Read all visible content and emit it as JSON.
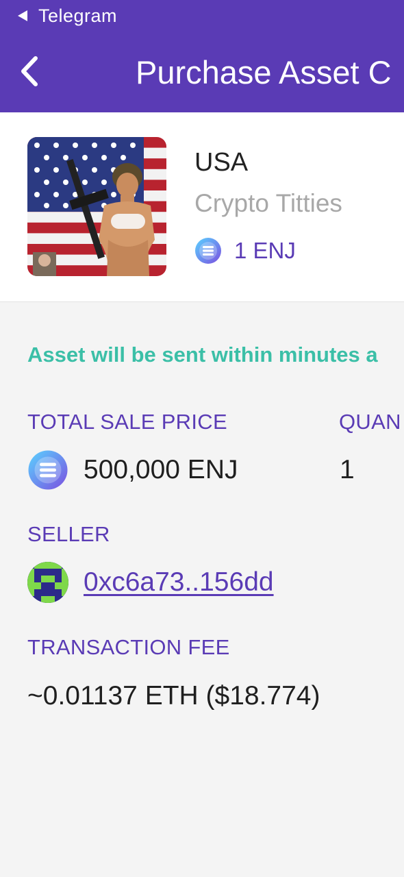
{
  "status_bar": {
    "back_app": "Telegram"
  },
  "header": {
    "title": "Purchase Asset C"
  },
  "asset": {
    "name": "USA",
    "collection": "Crypto Titties",
    "price": "1 ENJ",
    "image_icon": "asset-artwork-image",
    "token_icon": "enjin-coin-icon"
  },
  "details": {
    "notice": "Asset will be sent within minutes a",
    "total_sale_price_label": "TOTAL SALE PRICE",
    "total_sale_price_value": "500,000 ENJ",
    "quantity_label": "QUAN",
    "quantity_value": "1",
    "seller_label": "SELLER",
    "seller_address": "0xc6a73..156dd",
    "seller_avatar_icon": "identicon-avatar",
    "transaction_fee_label": "TRANSACTION FEE",
    "transaction_fee_value": "~0.01137 ETH ($18.774)"
  },
  "colors": {
    "header_bg": "#5a3bb5",
    "accent": "#5a3bb5",
    "notice": "#3bbfa7",
    "muted": "#a8a8a8",
    "page_bg": "#f4f4f4"
  }
}
